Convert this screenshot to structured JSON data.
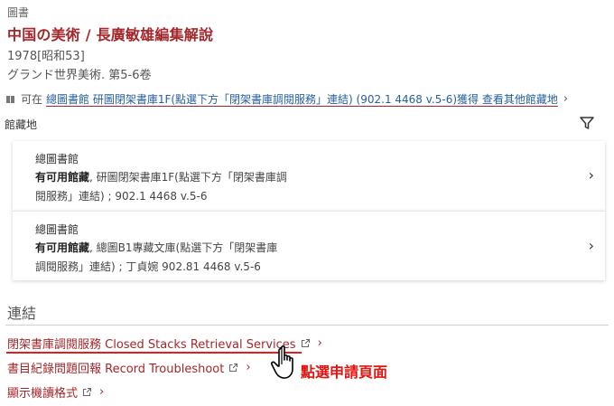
{
  "record": {
    "type_label": "圖書",
    "title": "中国の美術 / 長廣敏雄編集解說",
    "pub_date": "1978[昭和53]",
    "series": "グランド世界美術. 第5-6卷"
  },
  "availability": {
    "icon": "book-icon",
    "status": "可在",
    "location_text": "總圖書館  研圖閉架書庫1F(點選下方「閉架書庫調閱服務」連結) (902.1 4468 v.5-6)獲得 查看其他館藏地"
  },
  "holdings": {
    "title": "館藏地",
    "filter_icon": "filter-icon",
    "items": [
      {
        "library": "總圖書館",
        "avail_label": "有可用館藏",
        "detail_line1": ", 研圖閉架書庫1F(點選下方「閉架書庫調",
        "detail_line2": "閱服務」連結) ; 902.1 4468 v.5-6"
      },
      {
        "library": "總圖書館",
        "avail_label": "有可用館藏",
        "detail_line1": ", 總圖B1專藏文庫(點選下方「閉架書庫",
        "detail_line2": "調閱服務」連結) ; 丁貞婉 902.81 4468 v.5-6"
      }
    ]
  },
  "links": {
    "heading": "連結",
    "items": [
      {
        "label": "閉架書庫調閱服務 Closed Stacks Retrieval Services"
      },
      {
        "label": "書目紀錄問題回報 Record Troubleshoot"
      },
      {
        "label": "顯示機讀格式"
      }
    ]
  },
  "annotation": {
    "text": "點選申請頁面",
    "color": "#e3140f"
  },
  "colors": {
    "brand_red": "#a5272b",
    "link_blue": "#27609f"
  }
}
